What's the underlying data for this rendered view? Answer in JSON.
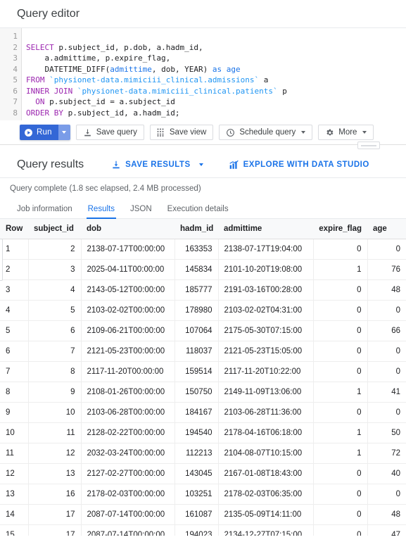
{
  "editor": {
    "title": "Query editor",
    "lines": [
      {
        "n": "1",
        "tokens": []
      },
      {
        "n": "2",
        "tokens": [
          {
            "t": "SELECT",
            "c": "kw"
          },
          {
            "t": " p.subject_id, p.dob, a.hadm_id,",
            "c": "plain"
          }
        ]
      },
      {
        "n": "3",
        "tokens": [
          {
            "t": "    a.admittime, p.expire_flag,",
            "c": "plain"
          }
        ]
      },
      {
        "n": "4",
        "tokens": [
          {
            "t": "    DATETIME_DIFF(",
            "c": "plain"
          },
          {
            "t": "admittime",
            "c": "id"
          },
          {
            "t": ", dob, YEAR) ",
            "c": "plain"
          },
          {
            "t": "as",
            "c": "id"
          },
          {
            "t": " ",
            "c": "plain"
          },
          {
            "t": "age",
            "c": "id"
          }
        ]
      },
      {
        "n": "5",
        "tokens": [
          {
            "t": "FROM",
            "c": "kw"
          },
          {
            "t": " ",
            "c": "plain"
          },
          {
            "t": "`physionet-data.mimiciii_clinical.admissions`",
            "c": "tbl"
          },
          {
            "t": " a",
            "c": "plain"
          }
        ]
      },
      {
        "n": "6",
        "tokens": [
          {
            "t": "INNER JOIN",
            "c": "kw"
          },
          {
            "t": " ",
            "c": "plain"
          },
          {
            "t": "`physionet-data.mimiciii_clinical.patients`",
            "c": "tbl"
          },
          {
            "t": " p",
            "c": "plain"
          }
        ]
      },
      {
        "n": "7",
        "tokens": [
          {
            "t": "  ",
            "c": "plain"
          },
          {
            "t": "ON",
            "c": "kw"
          },
          {
            "t": " p.subject_id = a.subject_id",
            "c": "plain"
          }
        ]
      },
      {
        "n": "8",
        "tokens": [
          {
            "t": "ORDER BY",
            "c": "kw"
          },
          {
            "t": " p.subject_id, a.hadm_id;",
            "c": "plain"
          }
        ]
      }
    ]
  },
  "toolbar": {
    "run_label": "Run",
    "save_query_label": "Save query",
    "save_view_label": "Save view",
    "schedule_query_label": "Schedule query",
    "more_label": "More"
  },
  "results": {
    "title": "Query results",
    "save_results_label": "SAVE RESULTS",
    "explore_label": "EXPLORE WITH DATA STUDIO",
    "status": "Query complete (1.8 sec elapsed, 2.4 MB processed)",
    "tabs": [
      {
        "label": "Job information",
        "active": false
      },
      {
        "label": "Results",
        "active": true
      },
      {
        "label": "JSON",
        "active": false
      },
      {
        "label": "Execution details",
        "active": false
      }
    ],
    "columns": [
      "Row",
      "subject_id",
      "dob",
      "hadm_id",
      "admittime",
      "expire_flag",
      "age"
    ],
    "rows": [
      [
        "1",
        "2",
        "2138-07-17T00:00:00",
        "163353",
        "2138-07-17T19:04:00",
        "0",
        "0"
      ],
      [
        "2",
        "3",
        "2025-04-11T00:00:00",
        "145834",
        "2101-10-20T19:08:00",
        "1",
        "76"
      ],
      [
        "3",
        "4",
        "2143-05-12T00:00:00",
        "185777",
        "2191-03-16T00:28:00",
        "0",
        "48"
      ],
      [
        "4",
        "5",
        "2103-02-02T00:00:00",
        "178980",
        "2103-02-02T04:31:00",
        "0",
        "0"
      ],
      [
        "5",
        "6",
        "2109-06-21T00:00:00",
        "107064",
        "2175-05-30T07:15:00",
        "0",
        "66"
      ],
      [
        "6",
        "7",
        "2121-05-23T00:00:00",
        "118037",
        "2121-05-23T15:05:00",
        "0",
        "0"
      ],
      [
        "7",
        "8",
        "2117-11-20T00:00:00",
        "159514",
        "2117-11-20T10:22:00",
        "0",
        "0"
      ],
      [
        "8",
        "9",
        "2108-01-26T00:00:00",
        "150750",
        "2149-11-09T13:06:00",
        "1",
        "41"
      ],
      [
        "9",
        "10",
        "2103-06-28T00:00:00",
        "184167",
        "2103-06-28T11:36:00",
        "0",
        "0"
      ],
      [
        "10",
        "11",
        "2128-02-22T00:00:00",
        "194540",
        "2178-04-16T06:18:00",
        "1",
        "50"
      ],
      [
        "11",
        "12",
        "2032-03-24T00:00:00",
        "112213",
        "2104-08-07T10:15:00",
        "1",
        "72"
      ],
      [
        "12",
        "13",
        "2127-02-27T00:00:00",
        "143045",
        "2167-01-08T18:43:00",
        "0",
        "40"
      ],
      [
        "13",
        "16",
        "2178-02-03T00:00:00",
        "103251",
        "2178-02-03T06:35:00",
        "0",
        "0"
      ],
      [
        "14",
        "17",
        "2087-07-14T00:00:00",
        "161087",
        "2135-05-09T14:11:00",
        "0",
        "48"
      ],
      [
        "15",
        "17",
        "2087-07-14T00:00:00",
        "194023",
        "2134-12-27T07:15:00",
        "0",
        "47"
      ]
    ]
  },
  "colors": {
    "accent_blue": "#1a73e8",
    "run_blue": "#3367d6",
    "run_arrow_blue": "#7a9ce8",
    "keyword_purple": "#9c27b0",
    "table_ref_blue": "#2196f3",
    "text_primary": "#202124",
    "text_secondary": "#5f6368"
  }
}
